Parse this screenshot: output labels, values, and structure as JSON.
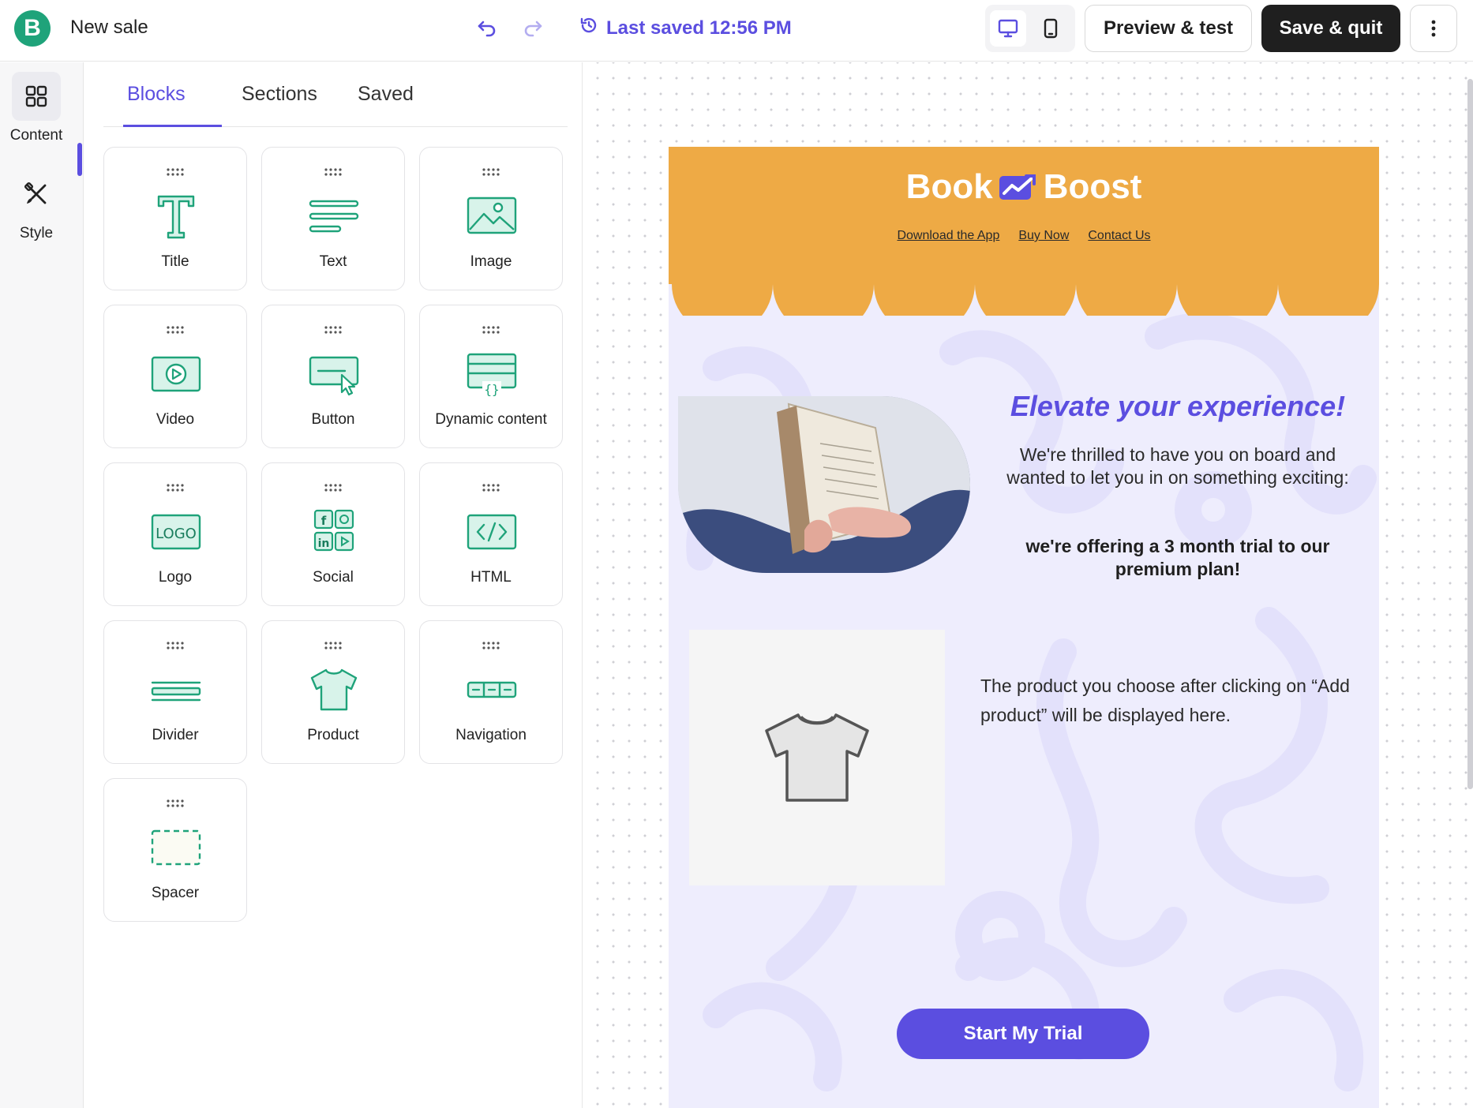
{
  "app": {
    "title": "New sale",
    "last_saved": "Last saved 12:56 PM",
    "preview_label": "Preview & test",
    "save_label": "Save & quit",
    "accent": "#5b4ee0",
    "brand_green": "#1fa37a",
    "logo_letter": "B"
  },
  "rail": {
    "content_label": "Content",
    "style_label": "Style"
  },
  "panel": {
    "tabs": [
      "Blocks",
      "Sections",
      "Saved"
    ],
    "active_tab": "Blocks",
    "blocks": [
      {
        "label": "Title",
        "icon": "title-icon"
      },
      {
        "label": "Text",
        "icon": "text-icon"
      },
      {
        "label": "Image",
        "icon": "image-icon"
      },
      {
        "label": "Video",
        "icon": "video-icon"
      },
      {
        "label": "Button",
        "icon": "button-icon"
      },
      {
        "label": "Dynamic content",
        "icon": "dynamic-content-icon"
      },
      {
        "label": "Logo",
        "icon": "logo-icon"
      },
      {
        "label": "Social",
        "icon": "social-icon"
      },
      {
        "label": "HTML",
        "icon": "html-icon"
      },
      {
        "label": "Divider",
        "icon": "divider-icon"
      },
      {
        "label": "Product",
        "icon": "product-icon"
      },
      {
        "label": "Navigation",
        "icon": "navigation-icon"
      },
      {
        "label": "Spacer",
        "icon": "spacer-icon"
      }
    ]
  },
  "email": {
    "brand_left": "Book",
    "brand_right": "Boost",
    "nav": [
      "Download the App",
      "Buy Now",
      "Contact Us"
    ],
    "header_color": "#eeaa45",
    "body_color": "#eeedfd",
    "hero_title": "Elevate your experience!",
    "hero_p1": "We're thrilled to have you on board and wanted to let you in on something exciting:",
    "hero_p2": "we're offering a 3 month trial to our premium plan!",
    "product_text": "The product you choose after clicking on “Add product” will be displayed here.",
    "cta_label": "Start My Trial"
  }
}
